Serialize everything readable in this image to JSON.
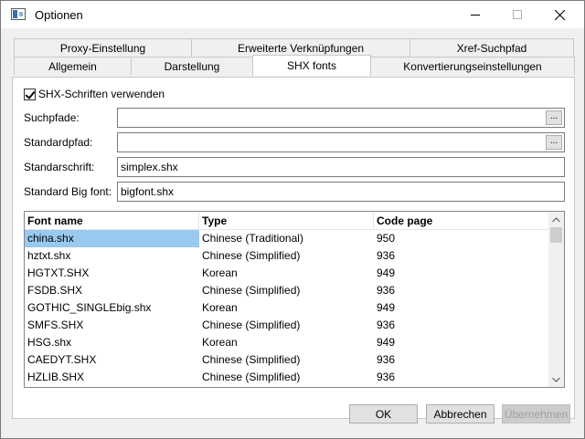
{
  "window": {
    "title": "Optionen"
  },
  "tabs": {
    "row_top": [
      "Proxy-Einstellung",
      "Erweiterte Verknüpfungen",
      "Xref-Suchpfad"
    ],
    "row_bottom": [
      "Allgemein",
      "Darstellung",
      "SHX fonts",
      "Konvertierungseinstellungen"
    ],
    "active": "SHX fonts"
  },
  "shx": {
    "use_checkbox_label": "SHX-Schriften verwenden",
    "use_checked": true,
    "search_paths_label": "Suchpfade:",
    "search_paths_value": "",
    "default_path_label": "Standardpfad:",
    "default_path_value": "",
    "browse_label": "...",
    "default_font_label": "Standarschrift:",
    "default_font_value": "simplex.shx",
    "big_font_label": "Standard Big font:",
    "big_font_value": "bigfont.shx"
  },
  "font_list": {
    "columns": [
      "Font name",
      "Type",
      "Code page"
    ],
    "rows": [
      [
        "china.shx",
        "Chinese (Traditional)",
        "950"
      ],
      [
        "hztxt.shx",
        "Chinese (Simplified)",
        "936"
      ],
      [
        "HGTXT.SHX",
        "Korean",
        "949"
      ],
      [
        "FSDB.SHX",
        "Chinese (Simplified)",
        "936"
      ],
      [
        "GOTHIC_SINGLEbig.shx",
        "Korean",
        "949"
      ],
      [
        "SMFS.SHX",
        "Chinese (Simplified)",
        "936"
      ],
      [
        "HSG.shx",
        "Korean",
        "949"
      ],
      [
        "CAEDYT.SHX",
        "Chinese (Simplified)",
        "936"
      ],
      [
        "HZLIB.SHX",
        "Chinese (Simplified)",
        "936"
      ]
    ],
    "selected_index": 0
  },
  "buttons": {
    "ok": "OK",
    "cancel": "Abbrechen",
    "apply": "Übernehmen"
  },
  "icons": [
    "app-icon",
    "minimize-icon",
    "maximize-icon",
    "close-icon",
    "checkmark-icon",
    "scroll-up-icon",
    "scroll-down-icon"
  ]
}
